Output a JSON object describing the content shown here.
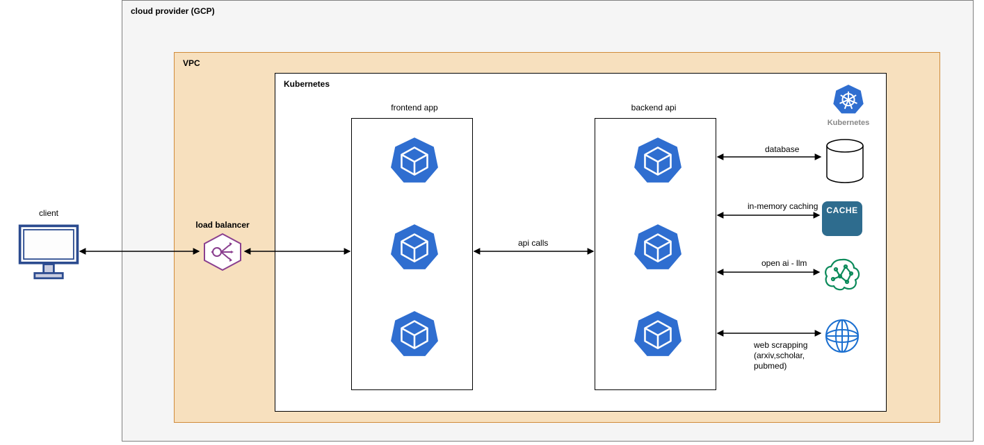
{
  "labels": {
    "client": "client",
    "cloud_provider": "cloud provider (GCP)",
    "vpc": "VPC",
    "kubernetes": "Kubernetes",
    "load_balancer": "load balancer",
    "frontend_app": "frontend app",
    "backend_api": "backend api",
    "api_calls": "api calls",
    "kubernetes_logo": "Kubernetes",
    "database": "database",
    "in_memory": "in-memory caching",
    "cache_badge": "CACHE",
    "open_ai": "open ai - llm",
    "web_scrapping": "web scrapping\n(arxiv,scholar,\npubmed)"
  }
}
